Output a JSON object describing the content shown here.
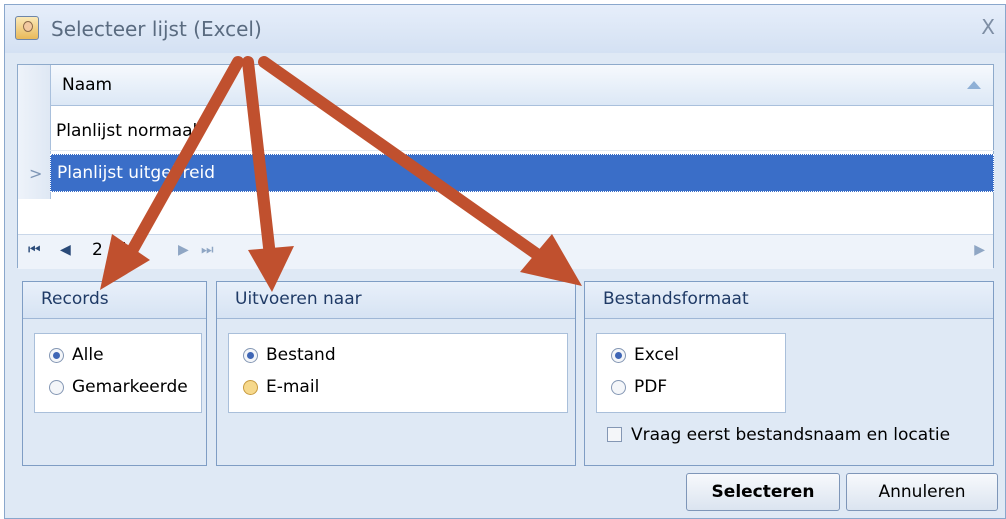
{
  "window": {
    "title": "Selecteer lijst (Excel)",
    "close_glyph": "X"
  },
  "grid": {
    "column_header": "Naam",
    "rows": [
      "Planlijst normaal",
      "Planlijst uitgebreid"
    ],
    "selected_row": 1,
    "row_indicator_glyph": ">",
    "pager": {
      "text": "2 of 2",
      "first": "⏮",
      "prev": "◀",
      "next": "▶",
      "last": "⏭",
      "scroll_right": "▶"
    }
  },
  "groups": {
    "records": {
      "title": "Records",
      "options": [
        "Alle",
        "Gemarkeerde"
      ],
      "selected": 0
    },
    "output": {
      "title": "Uitvoeren naar",
      "options": [
        "Bestand",
        "E-mail"
      ],
      "selected": 0
    },
    "format": {
      "title": "Bestandsformaat",
      "options": [
        "Excel",
        "PDF"
      ],
      "selected": 0,
      "ask_first_label": "Vraag eerst bestandsnaam en locatie",
      "ask_first_checked": false
    }
  },
  "buttons": {
    "select": "Selecteren",
    "cancel": "Annuleren"
  },
  "colors": {
    "arrow": "#c0502e",
    "selection": "#3a6ec8",
    "panel_bg": "#dfe9f5"
  }
}
